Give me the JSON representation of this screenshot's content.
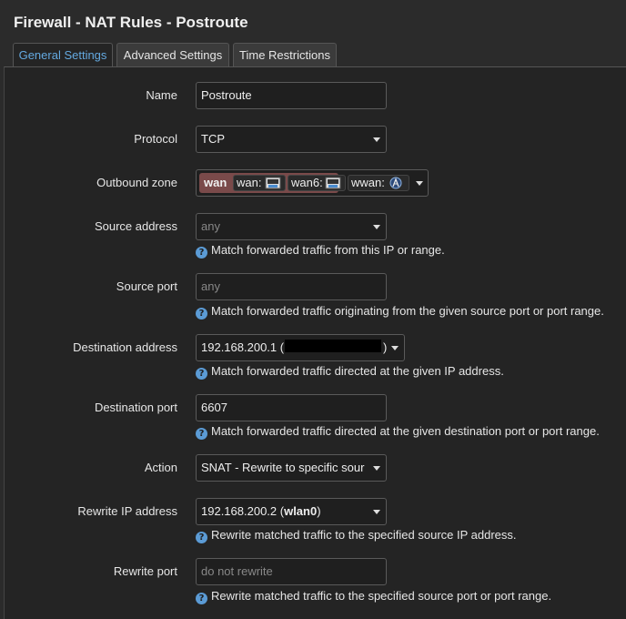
{
  "page": {
    "title": "Firewall - NAT Rules - Postroute"
  },
  "tabs": [
    {
      "label": "General Settings",
      "active": true
    },
    {
      "label": "Advanced Settings",
      "active": false
    },
    {
      "label": "Time Restrictions",
      "active": false
    }
  ],
  "form": {
    "name": {
      "label": "Name",
      "value": "Postroute"
    },
    "protocol": {
      "label": "Protocol",
      "value": "TCP"
    },
    "outbound_zone": {
      "label": "Outbound zone",
      "zone": "wan",
      "interfaces": [
        {
          "label": "wan:",
          "icon": "ethernet-port-icon"
        },
        {
          "label": "wan6:",
          "icon": "ethernet-port-icon"
        },
        {
          "label": "wwan:",
          "icon": "wireless-icon"
        }
      ]
    },
    "source_address": {
      "label": "Source address",
      "placeholder": "any",
      "help": "Match forwarded traffic from this IP or range."
    },
    "source_port": {
      "label": "Source port",
      "placeholder": "any",
      "help": "Match forwarded traffic originating from the given source port or port range."
    },
    "destination_address": {
      "label": "Destination address",
      "value_prefix": "192.168.200.1 (",
      "value_suffix": ")",
      "help": "Match forwarded traffic directed at the given IP address."
    },
    "destination_port": {
      "label": "Destination port",
      "value": "6607",
      "help": "Match forwarded traffic directed at the given destination port or port range."
    },
    "action": {
      "label": "Action",
      "value": "SNAT - Rewrite to specific sour"
    },
    "rewrite_ip": {
      "label": "Rewrite IP address",
      "value_ip": "192.168.200.2 (",
      "value_iface": "wlan0",
      "value_close": ")",
      "help": "Rewrite matched traffic to the specified source IP address."
    },
    "rewrite_port": {
      "label": "Rewrite port",
      "placeholder": "do not rewrite",
      "help": "Rewrite matched traffic to the specified source port or port range."
    }
  },
  "colors": {
    "background": "#242424",
    "active_tab_text": "#64a9e0",
    "zone_wan": "#7a4a4a",
    "help_icon": "#5b9bd5"
  }
}
